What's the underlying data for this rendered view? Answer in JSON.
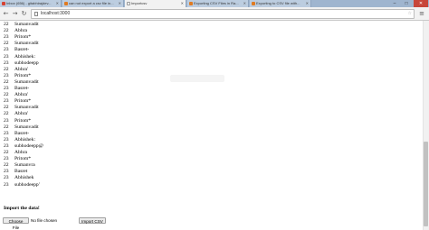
{
  "tabs": [
    {
      "label": "Inbox (656) - gitabhirajdev...",
      "icon_color": "#d64333"
    },
    {
      "label": "can not export a csv file in...",
      "icon_color": "#e07b22"
    },
    {
      "label": "Importcsv",
      "icon_color": "#ffffff",
      "active": true
    },
    {
      "label": "Exporting CSV Files in Ra...",
      "icon_color": "#e07b22"
    },
    {
      "label": "Exporting to CSV file with...",
      "icon_color": "#e07b22"
    }
  ],
  "window_controls": {
    "minimize": "–",
    "maximize": "□",
    "close": "✕"
  },
  "address_bar": {
    "url": "localhost:3000"
  },
  "rows": [
    {
      "age": "22",
      "name": "Sumanvadit"
    },
    {
      "age": "22",
      "name": "Abhra"
    },
    {
      "age": "23",
      "name": "Pritom*"
    },
    {
      "age": "22",
      "name": "Sumanvadit"
    },
    {
      "age": "23",
      "name": "Basret-"
    },
    {
      "age": "23",
      "name": "Abhishek:"
    },
    {
      "age": "23",
      "name": "subhodeepp"
    },
    {
      "age": "22",
      "name": "Abhra'"
    },
    {
      "age": "23",
      "name": "Pritom*"
    },
    {
      "age": "22",
      "name": "Sumanvadit"
    },
    {
      "age": "23",
      "name": "Basret-"
    },
    {
      "age": "22",
      "name": "Abhra'"
    },
    {
      "age": "23",
      "name": "Pritom*"
    },
    {
      "age": "22",
      "name": "Sumanvadit"
    },
    {
      "age": "22",
      "name": "Abhra'"
    },
    {
      "age": "23",
      "name": "Pritom*"
    },
    {
      "age": "22",
      "name": "Sumanvadit"
    },
    {
      "age": "23",
      "name": "Basret-"
    },
    {
      "age": "23",
      "name": "Abhishek:"
    },
    {
      "age": "23",
      "name": "subhodeepp@"
    },
    {
      "age": "22",
      "name": "Abhra"
    },
    {
      "age": "23",
      "name": "Pritom*"
    },
    {
      "age": "22",
      "name": "Sumanvra"
    },
    {
      "age": "23",
      "name": "Basret"
    },
    {
      "age": "23",
      "name": "Abhishek"
    },
    {
      "age": "23",
      "name": "subhodeepp'"
    }
  ],
  "import_section": {
    "title": "Import the data!",
    "choose_file_label": "Choose File",
    "no_file_label": "No file chosen",
    "import_button_label": "Import CSV"
  }
}
